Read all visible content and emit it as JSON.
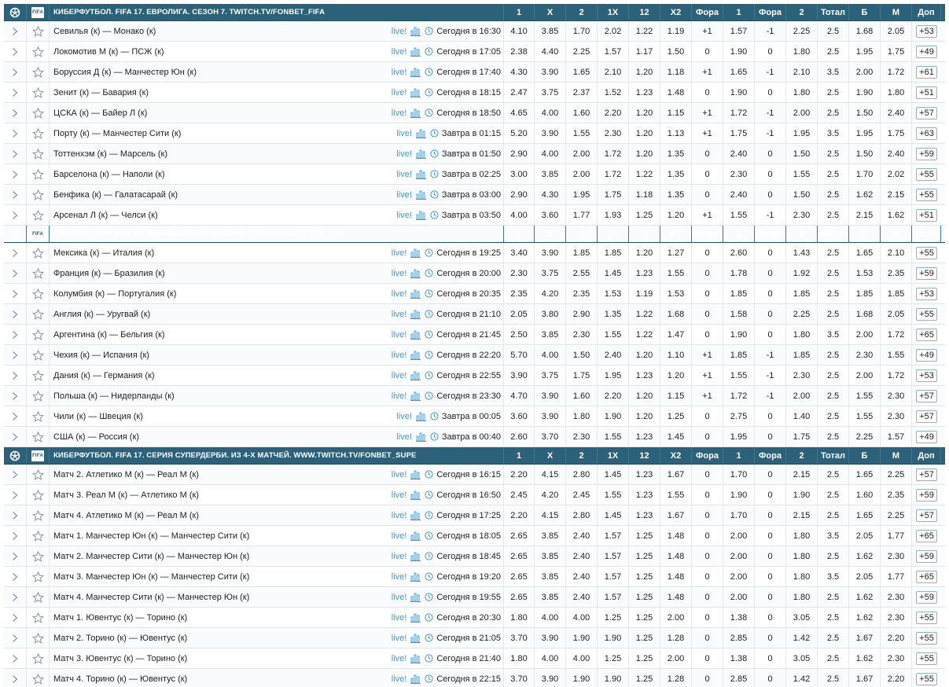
{
  "headers": [
    "1",
    "X",
    "2",
    "1X",
    "12",
    "X2",
    "Фора",
    "1",
    "Фора",
    "2",
    "Тотал",
    "Б",
    "М",
    "Доп"
  ],
  "labels": {
    "live": "live!"
  },
  "icons": {
    "expand": "chevron-right-icon",
    "favorite": "star-icon",
    "stats": "bar-chart-icon",
    "clock": "clock-icon",
    "sport": "soccer-ball-icon",
    "fifa_logo": "FIFA"
  },
  "colors": {
    "header_bg": "#2b6279",
    "live": "#3d9bd0"
  },
  "groups": [
    {
      "title": "КИБЕРФУТБОЛ. FIFA 17. ЕВРОЛИГА. СЕЗОН 7. TWITCH.TV/FONBET_FIFA",
      "events": [
        {
          "name": "Севилья (к) — Монако (к)",
          "time": "Сегодня в 16:30",
          "odds": [
            "4.10",
            "3.85",
            "1.70",
            "2.02",
            "1.22",
            "1.19",
            "+1",
            "1.57",
            "-1",
            "2.25",
            "2.5",
            "1.68",
            "2.05"
          ],
          "more": "+53"
        },
        {
          "name": "Локомотив М (к) — ПСЖ (к)",
          "time": "Сегодня в 17:05",
          "odds": [
            "2.38",
            "4.40",
            "2.25",
            "1.57",
            "1.17",
            "1.50",
            "0",
            "1.90",
            "0",
            "1.80",
            "2.5",
            "1.95",
            "1.75"
          ],
          "more": "+49"
        },
        {
          "name": "Боруссия Д (к) — Манчестер Юн (к)",
          "time": "Сегодня в 17:40",
          "odds": [
            "4.30",
            "3.90",
            "1.65",
            "2.10",
            "1.20",
            "1.18",
            "+1",
            "1.65",
            "-1",
            "2.10",
            "3.5",
            "2.00",
            "1.72"
          ],
          "more": "+61"
        },
        {
          "name": "Зенит (к) — Бавария (к)",
          "time": "Сегодня в 18:15",
          "odds": [
            "2.47",
            "3.75",
            "2.37",
            "1.52",
            "1.23",
            "1.48",
            "0",
            "1.90",
            "0",
            "1.80",
            "2.5",
            "1.90",
            "1.80"
          ],
          "more": "+51"
        },
        {
          "name": "ЦСКА (к) — Байер Л (к)",
          "time": "Сегодня в 18:50",
          "odds": [
            "4.65",
            "4.00",
            "1.60",
            "2.20",
            "1.20",
            "1.15",
            "+1",
            "1.72",
            "-1",
            "2.00",
            "2.5",
            "1.50",
            "2.40"
          ],
          "more": "+57"
        },
        {
          "name": "Порту (к) — Манчестер Сити (к)",
          "time": "Завтра в 01:15",
          "odds": [
            "5.20",
            "3.90",
            "1.55",
            "2.30",
            "1.20",
            "1.13",
            "+1",
            "1.75",
            "-1",
            "1.95",
            "3.5",
            "1.95",
            "1.75"
          ],
          "more": "+63"
        },
        {
          "name": "Тоттенхэм (к) — Марсель (к)",
          "time": "Завтра в 01:50",
          "odds": [
            "2.90",
            "4.00",
            "2.00",
            "1.72",
            "1.20",
            "1.35",
            "0",
            "2.40",
            "0",
            "1.50",
            "2.5",
            "1.50",
            "2.40"
          ],
          "more": "+59"
        },
        {
          "name": "Барселона (к) — Наполи (к)",
          "time": "Завтра в 02:25",
          "odds": [
            "3.00",
            "3.85",
            "2.00",
            "1.72",
            "1.22",
            "1.35",
            "0",
            "2.30",
            "0",
            "1.55",
            "2.5",
            "1.70",
            "2.02"
          ],
          "more": "+55"
        },
        {
          "name": "Бенфика (к) — Галатасарай (к)",
          "time": "Завтра в 03:00",
          "odds": [
            "2.90",
            "4.30",
            "1.95",
            "1.75",
            "1.18",
            "1.35",
            "0",
            "2.40",
            "0",
            "1.50",
            "2.5",
            "1.62",
            "2.15"
          ],
          "more": "+55"
        },
        {
          "name": "Арсенал Л (к) — Челси (к)",
          "time": "Завтра в 03:50",
          "odds": [
            "4.00",
            "3.60",
            "1.77",
            "1.93",
            "1.25",
            "1.20",
            "+1",
            "1.55",
            "-1",
            "2.30",
            "2.5",
            "2.15",
            "1.62"
          ],
          "more": "+51"
        }
      ]
    },
    {
      "title": "КИБЕРФУТБОЛ. FIFA 17. МИРОВАЯ ЛИГА. СЕЗОН 5. TWITCH.TV/FONBET_FIFA",
      "events": [
        {
          "name": "Мексика (к) — Италия (к)",
          "time": "Сегодня в 19:25",
          "odds": [
            "3.40",
            "3.90",
            "1.85",
            "1.85",
            "1.20",
            "1.27",
            "0",
            "2.60",
            "0",
            "1.43",
            "2.5",
            "1.65",
            "2.10"
          ],
          "more": "+55"
        },
        {
          "name": "Франция (к) — Бразилия (к)",
          "time": "Сегодня в 20:00",
          "odds": [
            "2.30",
            "3.75",
            "2.55",
            "1.45",
            "1.23",
            "1.55",
            "0",
            "1.78",
            "0",
            "1.92",
            "2.5",
            "1.53",
            "2.35"
          ],
          "more": "+59"
        },
        {
          "name": "Колумбия (к) — Португалия (к)",
          "time": "Сегодня в 20:35",
          "odds": [
            "2.35",
            "4.20",
            "2.35",
            "1.53",
            "1.19",
            "1.53",
            "0",
            "1.85",
            "0",
            "1.85",
            "2.5",
            "1.85",
            "1.85"
          ],
          "more": "+53"
        },
        {
          "name": "Англия (к) — Уругвай (к)",
          "time": "Сегодня в 21:10",
          "odds": [
            "2.05",
            "3.80",
            "2.90",
            "1.35",
            "1.22",
            "1.68",
            "0",
            "1.58",
            "0",
            "2.25",
            "2.5",
            "1.68",
            "2.05"
          ],
          "more": "+55"
        },
        {
          "name": "Аргентина (к) — Бельгия (к)",
          "time": "Сегодня в 21:45",
          "odds": [
            "2.50",
            "3.85",
            "2.30",
            "1.55",
            "1.22",
            "1.47",
            "0",
            "1.90",
            "0",
            "1.80",
            "3.5",
            "2.00",
            "1.72"
          ],
          "more": "+65"
        },
        {
          "name": "Чехия (к) — Испания (к)",
          "time": "Сегодня в 22:20",
          "odds": [
            "5.70",
            "4.00",
            "1.50",
            "2.40",
            "1.20",
            "1.10",
            "+1",
            "1.85",
            "-1",
            "1.85",
            "2.5",
            "2.30",
            "1.55"
          ],
          "more": "+49"
        },
        {
          "name": "Дания (к) — Германия (к)",
          "time": "Сегодня в 22:55",
          "odds": [
            "3.90",
            "3.75",
            "1.75",
            "1.95",
            "1.23",
            "1.20",
            "+1",
            "1.55",
            "-1",
            "2.30",
            "2.5",
            "2.00",
            "1.72"
          ],
          "more": "+53"
        },
        {
          "name": "Польша (к) — Нидерланды (к)",
          "time": "Сегодня в 23:30",
          "odds": [
            "4.70",
            "3.90",
            "1.60",
            "2.20",
            "1.20",
            "1.15",
            "+1",
            "1.72",
            "-1",
            "2.00",
            "2.5",
            "1.55",
            "2.30"
          ],
          "more": "+57"
        },
        {
          "name": "Чили (к) — Швеция (к)",
          "time": "Завтра в 00:05",
          "odds": [
            "3.60",
            "3.90",
            "1.80",
            "1.90",
            "1.20",
            "1.25",
            "0",
            "2.75",
            "0",
            "1.40",
            "2.5",
            "1.55",
            "2.30"
          ],
          "more": "+57"
        },
        {
          "name": "США (к) — Россия (к)",
          "time": "Завтра в 00:40",
          "odds": [
            "2.60",
            "3.70",
            "2.30",
            "1.55",
            "1.23",
            "1.45",
            "0",
            "1.95",
            "0",
            "1.75",
            "2.5",
            "2.25",
            "1.57"
          ],
          "more": "+49"
        }
      ]
    },
    {
      "title": "КИБЕРФУТБОЛ. FIFA 17. СЕРИЯ СУПЕРДЕРБИ. ИЗ 4-Х МАТЧЕЙ. WWW.TWITCH.TV/FONBET_SUPE",
      "events": [
        {
          "name": "Матч 2. Атлетико М (к) — Реал М (к)",
          "time": "Сегодня в 16:15",
          "odds": [
            "2.20",
            "4.15",
            "2.80",
            "1.45",
            "1.23",
            "1.67",
            "0",
            "1.70",
            "0",
            "2.15",
            "2.5",
            "1.65",
            "2.25"
          ],
          "more": "+57"
        },
        {
          "name": "Матч 3. Реал М (к) — Атлетико М (к)",
          "time": "Сегодня в 16:50",
          "odds": [
            "2.45",
            "4.20",
            "2.45",
            "1.55",
            "1.23",
            "1.55",
            "0",
            "1.90",
            "0",
            "1.90",
            "2.5",
            "1.60",
            "2.35"
          ],
          "more": "+59"
        },
        {
          "name": "Матч 4. Атлетико М (к) — Реал М (к)",
          "time": "Сегодня в 17:25",
          "odds": [
            "2.20",
            "4.15",
            "2.80",
            "1.45",
            "1.23",
            "1.67",
            "0",
            "1.70",
            "0",
            "2.15",
            "2.5",
            "1.65",
            "2.25"
          ],
          "more": "+57"
        },
        {
          "name": "Матч 1. Манчестер Юн (к) — Манчестер Сити (к)",
          "time": "Сегодня в 18:05",
          "odds": [
            "2.65",
            "3.85",
            "2.40",
            "1.57",
            "1.25",
            "1.48",
            "0",
            "2.00",
            "0",
            "1.80",
            "3.5",
            "2.05",
            "1.77"
          ],
          "more": "+65"
        },
        {
          "name": "Матч 2. Манчестер Сити (к) — Манчестер Юн (к)",
          "time": "Сегодня в 18:45",
          "odds": [
            "2.65",
            "3.85",
            "2.40",
            "1.57",
            "1.25",
            "1.48",
            "0",
            "2.00",
            "0",
            "1.80",
            "2.5",
            "1.62",
            "2.30"
          ],
          "more": "+59"
        },
        {
          "name": "Матч 3. Манчестер Юн (к) — Манчестер Сити (к)",
          "time": "Сегодня в 19:20",
          "odds": [
            "2.65",
            "3.85",
            "2.40",
            "1.57",
            "1.25",
            "1.48",
            "0",
            "2.00",
            "0",
            "1.80",
            "3.5",
            "2.05",
            "1.77"
          ],
          "more": "+65"
        },
        {
          "name": "Матч 4. Манчестер Сити (к) — Манчестер Юн (к)",
          "time": "Сегодня в 19:55",
          "odds": [
            "2.65",
            "3.85",
            "2.40",
            "1.57",
            "1.25",
            "1.48",
            "0",
            "2.00",
            "0",
            "1.80",
            "2.5",
            "1.62",
            "2.30"
          ],
          "more": "+59"
        },
        {
          "name": "Матч 1. Ювентус (к) — Торино (к)",
          "time": "Сегодня в 20:30",
          "odds": [
            "1.80",
            "4.00",
            "4.00",
            "1.25",
            "1.25",
            "2.00",
            "0",
            "1.38",
            "0",
            "3.05",
            "2.5",
            "1.62",
            "2.30"
          ],
          "more": "+55"
        },
        {
          "name": "Матч 2. Торино (к) — Ювентус (к)",
          "time": "Сегодня в 21:05",
          "odds": [
            "3.70",
            "3.90",
            "1.90",
            "1.90",
            "1.25",
            "1.28",
            "0",
            "2.85",
            "0",
            "1.42",
            "2.5",
            "1.67",
            "2.20"
          ],
          "more": "+55"
        },
        {
          "name": "Матч 3. Ювентус (к) — Торино (к)",
          "time": "Сегодня в 21:40",
          "odds": [
            "1.80",
            "4.00",
            "4.00",
            "1.25",
            "1.25",
            "2.00",
            "0",
            "1.38",
            "0",
            "3.05",
            "2.5",
            "1.62",
            "2.30"
          ],
          "more": "+55"
        },
        {
          "name": "Матч 4. Торино (к) — Ювентус (к)",
          "time": "Сегодня в 22:15",
          "odds": [
            "3.70",
            "3.90",
            "1.90",
            "1.90",
            "1.25",
            "1.28",
            "0",
            "2.85",
            "0",
            "1.42",
            "2.5",
            "1.67",
            "2.20"
          ],
          "more": "+55"
        }
      ]
    }
  ]
}
